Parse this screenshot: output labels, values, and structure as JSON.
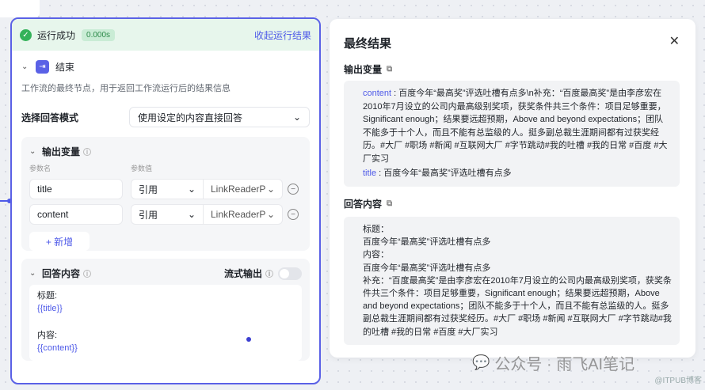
{
  "run": {
    "status": "运行成功",
    "time": "0.000s",
    "collapse": "收起运行结果"
  },
  "node": {
    "title": "结束",
    "description": "工作流的最终节点，用于返回工作流运行后的结果信息"
  },
  "mode": {
    "label": "选择回答模式",
    "value": "使用设定的内容直接回答"
  },
  "outputs": {
    "title": "输出变量",
    "col_name": "参数名",
    "col_value": "参数值",
    "rows": [
      {
        "name": "title",
        "type": "引用",
        "source": "LinkReaderP"
      },
      {
        "name": "content",
        "type": "引用",
        "source": "LinkReaderP"
      }
    ],
    "add_label": "+ 新增"
  },
  "answer": {
    "title": "回答内容",
    "stream_label": "流式输出",
    "lines": [
      "标题:",
      "{{title}}",
      "",
      "内容:",
      "{{content}}"
    ]
  },
  "result": {
    "title": "最终结果",
    "output_section": "输出变量",
    "content_key": "content",
    "content_value": "百度今年“最高奖”评选吐槽有点多\\n补充：“百度最高奖”是由李彦宏在2010年7月设立的公司内最高级别奖项，获奖条件共三个条件：项目足够重要，Significant enough；结果要远超预期，Above and beyond expectations；团队不能多于十个人，而且不能有总监级的人。挺多副总裁生涯期间都有过获奖经历。#大厂 #职场 #新闻 #互联网大厂 #字节跳动#我的吐槽 #我的日常 #百度 #大厂实习",
    "title_key": "title",
    "title_value": "百度今年“最高奖”评选吐槽有点多",
    "answer_section": "回答内容",
    "answer_lines": [
      "标题：",
      "百度今年“最高奖”评选吐槽有点多",
      "内容：",
      "百度今年“最高奖”评选吐槽有点多",
      "补充：“百度最高奖”是由李彦宏在2010年7月设立的公司内最高级别奖项，获奖条件共三个条件：项目足够重要，Significant enough；结果要远超预期，Above and beyond expectations；团队不能多于十个人，而且不能有总监级的人。挺多副总裁生涯期间都有过获奖经历。#大厂 #职场 #新闻 #互联网大厂 #字节跳动#我的吐槽 #我的日常 #百度 #大厂实习"
    ]
  },
  "watermark": {
    "text": "公众号 · 雨飞AI笔记",
    "tag": "@ITPUB博客"
  }
}
